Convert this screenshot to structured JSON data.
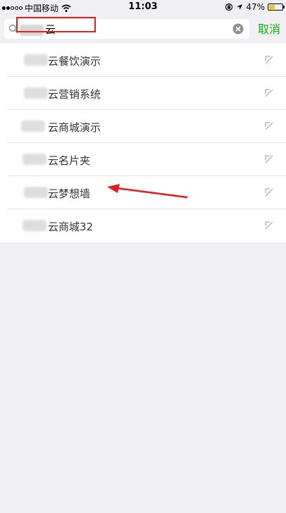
{
  "status_bar": {
    "carrier": "中国移动",
    "time": "11:03",
    "battery_percent": "47%",
    "battery_level": 0.47,
    "battery_color": "#f5c518"
  },
  "search": {
    "query_suffix": "云",
    "cancel_label": "取消",
    "icons": [
      "search-icon",
      "clear-icon"
    ]
  },
  "results": [
    {
      "label": "云餐饮演示"
    },
    {
      "label": "云营销系统"
    },
    {
      "label": "云商城演示"
    },
    {
      "label": "云名片夹"
    },
    {
      "label": "云梦想墙"
    },
    {
      "label": "云商城32"
    }
  ],
  "colors": {
    "accent_green": "#1aad19",
    "annotation_red": "#e02020",
    "background": "#efeff4"
  }
}
